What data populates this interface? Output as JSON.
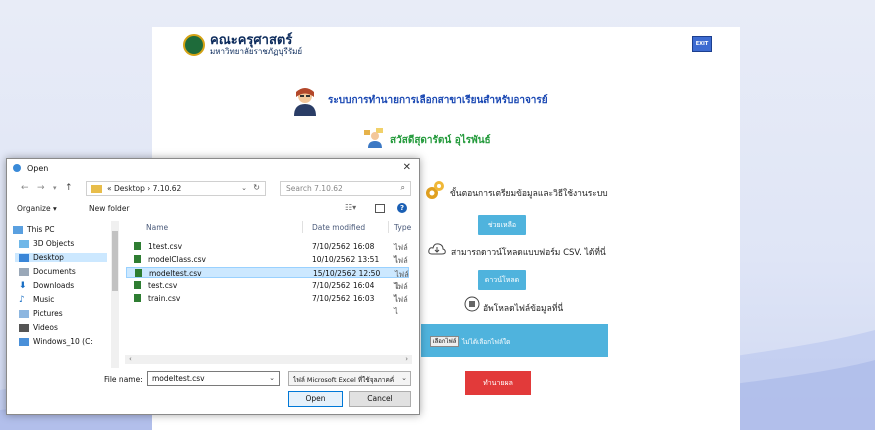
{
  "web": {
    "logo_title": "คณะครุศาสตร์",
    "logo_subtitle": "มหาวิทยาลัยราชภัฏบุรีรัมย์",
    "exit_label": "EXIT",
    "system_title": "ระบบการทำนายการเลือกสาขาเรียนสำหรับอาจารย์",
    "welcome": "สวัสดีสุดารัตน์ อุไรพันธ์",
    "steps_text": "ขั้นตอนการเตรียมข้อมูลและวิธีใช้งานระบบ",
    "help_button": "ช่วยเหลือ",
    "template_text": "สามารถดาวน์โหลดแบบฟอร์ม CSV. ได้ที่นี่",
    "download_button": "ดาวน์โหลด",
    "upload_text": "อัพโหลดไฟล์ข้อมูลที่นี่",
    "choose_file_button": "เลือกไฟล์",
    "no_file_text": "ไม่ได้เลือกไฟล์ใด",
    "predict_button": "ทำนายผล"
  },
  "dialog": {
    "title": "Open",
    "close": "✕",
    "address": "« Desktop › 7.10.62",
    "search_placeholder": "Search 7.10.62",
    "organize": "Organize ▾",
    "new_folder": "New folder",
    "nav_items": [
      "This PC",
      "3D Objects",
      "Desktop",
      "Documents",
      "Downloads",
      "Music",
      "Pictures",
      "Videos",
      "Windows_10 (C:"
    ],
    "columns": {
      "name": "Name",
      "date": "Date modified",
      "type": "Type"
    },
    "files": [
      {
        "name": "1test.csv",
        "date": "7/10/2562 16:08",
        "type": "ไฟล์ไ"
      },
      {
        "name": "modelClass.csv",
        "date": "10/10/2562 13:51",
        "type": "ไฟล์ไ"
      },
      {
        "name": "modeltest.csv",
        "date": "15/10/2562 12:50",
        "type": "ไฟล์ไ"
      },
      {
        "name": "test.csv",
        "date": "7/10/2562 16:04",
        "type": "ไฟล์ไ"
      },
      {
        "name": "train.csv",
        "date": "7/10/2562 16:03",
        "type": "ไฟล์ไ"
      }
    ],
    "file_name_label": "File name:",
    "file_name_value": "modeltest.csv",
    "file_type_value": "ไฟล์ Microsoft Excel ที่ใช้จุลภาคคั่",
    "open_button": "Open",
    "cancel_button": "Cancel"
  },
  "colors": {
    "accent_blue": "#4fb3dd",
    "predict_red": "#e23a3a",
    "welcome_green": "#239a3b",
    "title_blue": "#1a48b3"
  }
}
